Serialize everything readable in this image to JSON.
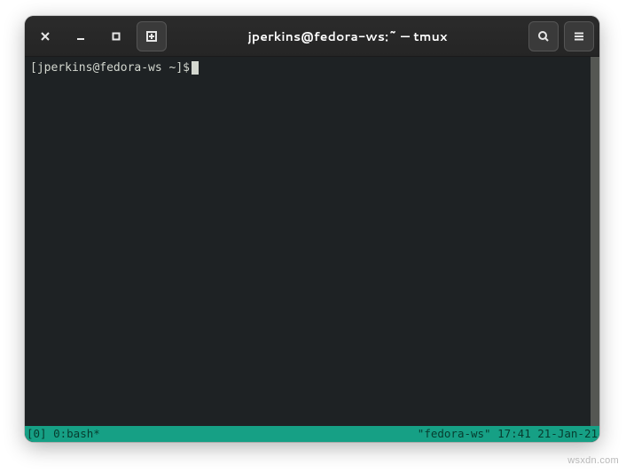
{
  "titlebar": {
    "title": "jperkins@fedora-ws:~ — tmux"
  },
  "terminal": {
    "prompt": "[jperkins@fedora-ws ~]$"
  },
  "tmux": {
    "left": "[0] 0:bash*",
    "right": "\"fedora-ws\" 17:41 21-Jan-21"
  },
  "watermark": "wsxdn.com"
}
